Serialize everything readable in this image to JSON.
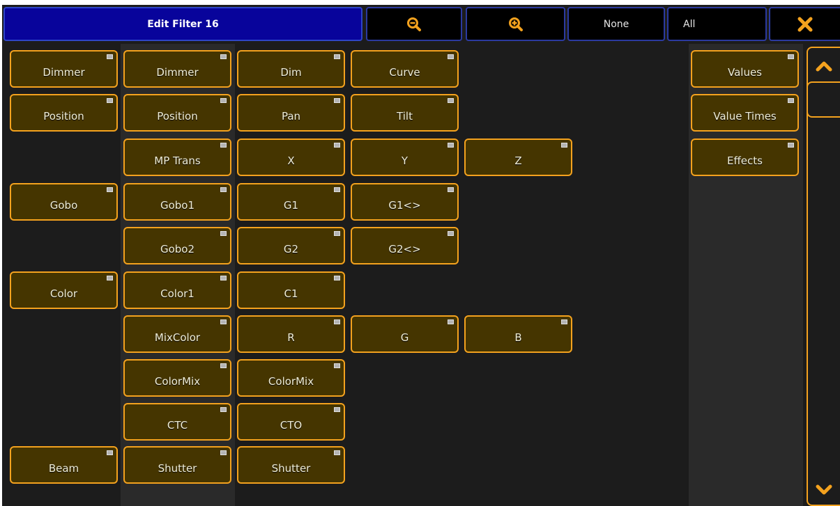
{
  "window": {
    "title": "Edit Filter 16",
    "zoom_out_icon": "zoom-out-icon",
    "zoom_in_icon": "zoom-in-icon",
    "none_label": "None",
    "all_label": "All",
    "close_icon": "close-icon"
  },
  "colors": {
    "accent": "#f4a21e",
    "button_fill": "#453500",
    "title_bg": "#08049b",
    "background": "#1c1c1c"
  },
  "features": [
    {
      "label": "Dimmer"
    },
    {
      "label": "Position"
    },
    {
      "label": "Gobo"
    },
    {
      "label": "Color"
    },
    {
      "label": "Beam"
    }
  ],
  "attributes": [
    {
      "label": "Dimmer"
    },
    {
      "label": "Position"
    },
    {
      "label": "MP Trans"
    },
    {
      "label": "Gobo1"
    },
    {
      "label": "Gobo2"
    },
    {
      "label": "Color1"
    },
    {
      "label": "MixColor"
    },
    {
      "label": "ColorMix"
    },
    {
      "label": "CTC"
    },
    {
      "label": "Shutter"
    }
  ],
  "channels": [
    {
      "label": "Dim"
    },
    {
      "label": "Curve"
    },
    {
      "label": "Pan"
    },
    {
      "label": "Tilt"
    },
    {
      "label": "X"
    },
    {
      "label": "Y"
    },
    {
      "label": "Z"
    },
    {
      "label": "G1"
    },
    {
      "label": "G1<>"
    },
    {
      "label": "G2"
    },
    {
      "label": "G2<>"
    },
    {
      "label": "C1"
    },
    {
      "label": "R"
    },
    {
      "label": "G"
    },
    {
      "label": "B"
    },
    {
      "label": "ColorMix"
    },
    {
      "label": "CTO"
    },
    {
      "label": "Shutter"
    }
  ],
  "value_types": [
    {
      "label": "Values"
    },
    {
      "label": "Value Times"
    },
    {
      "label": "Effects"
    }
  ],
  "scrollbar": {
    "up_icon": "chevron-up-icon",
    "down_icon": "chevron-down-icon"
  }
}
